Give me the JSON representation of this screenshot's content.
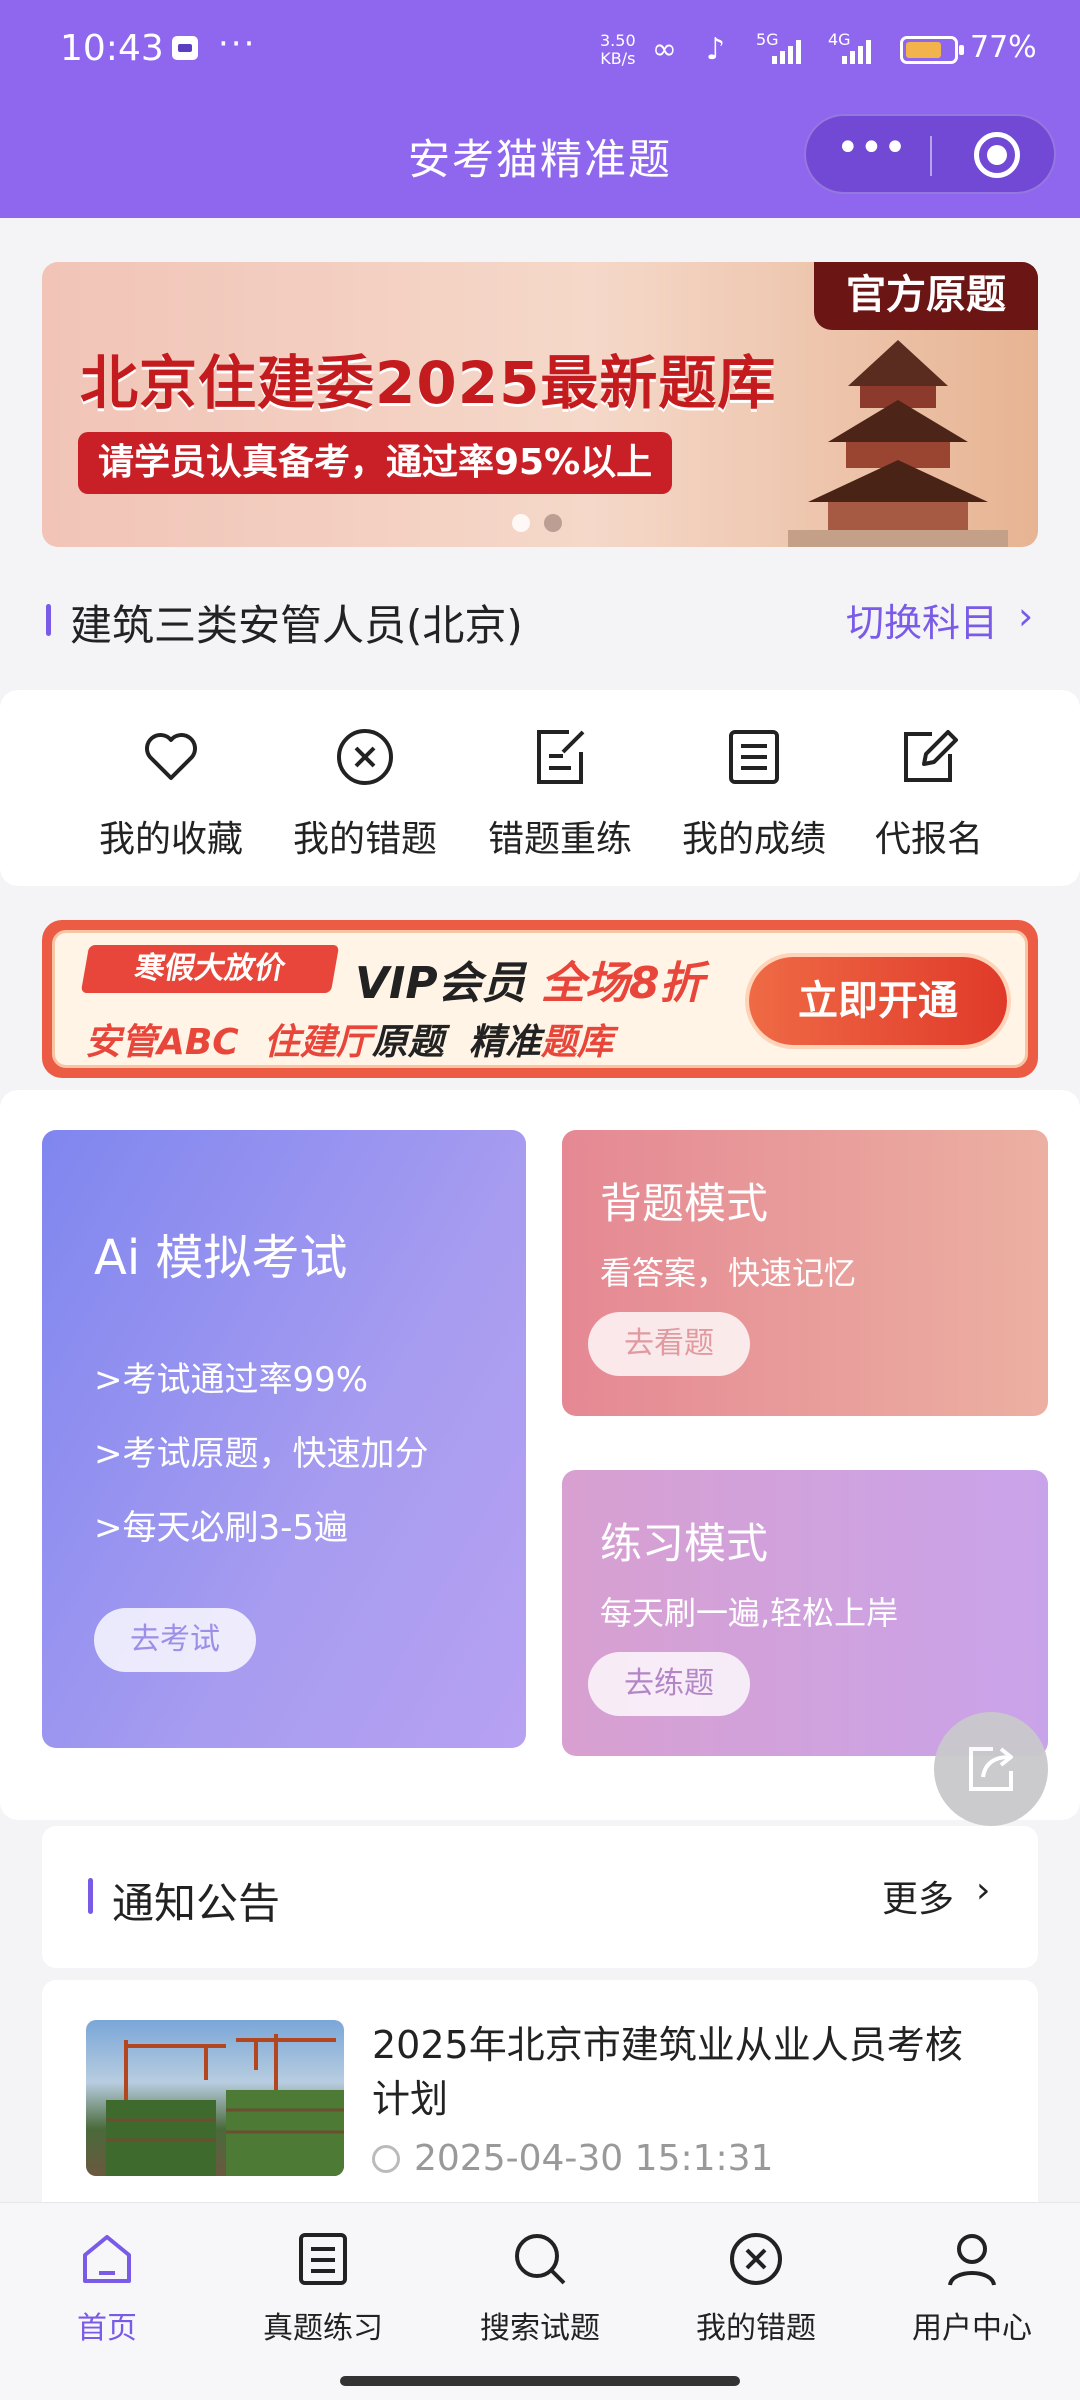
{
  "status_bar": {
    "time": "10:43",
    "dots": "···",
    "speed_value": "3.50",
    "speed_unit": "KB/s",
    "net1": "5G",
    "net2": "4G",
    "battery_percent_label": "77%",
    "battery_level": 0.77
  },
  "nav": {
    "title": "安考猫精准题",
    "more_icon": "more-dots-icon",
    "close_icon": "target-circle-icon"
  },
  "banner": {
    "tag": "官方原题",
    "headline": "北京住建委2025最新题库",
    "subline": "请学员认真备考，通过率95%以上",
    "slides": 2,
    "active_slide": 1
  },
  "subject": {
    "name": "建筑三类安管人员(北京)",
    "switch_label": "切换科目",
    "chevron": "›"
  },
  "quick_menu": [
    {
      "label": "我的收藏",
      "icon": "heart-icon"
    },
    {
      "label": "我的错题",
      "icon": "x-circle-icon"
    },
    {
      "label": "错题重练",
      "icon": "edit-doc-icon"
    },
    {
      "label": "我的成绩",
      "icon": "doc-lines-icon"
    },
    {
      "label": "代报名",
      "icon": "pencil-square-icon"
    }
  ],
  "promo": {
    "tag": "寒假大放价",
    "vip_prefix": "VIP会员",
    "vip_highlight": "全场8折",
    "line2_a": "安管ABC",
    "line2_b": "住建厅",
    "line2_c": "原题",
    "line2_d": "精准",
    "line2_e": "题库",
    "cta": "立即开通"
  },
  "modes": {
    "exam": {
      "title": "Ai 模拟考试",
      "points": [
        ">考试通过率99%",
        ">考试原题，快速加分",
        ">每天必刷3-5遍"
      ],
      "button": "去考试"
    },
    "recite": {
      "title": "背题模式",
      "desc": "看答案，快速记忆",
      "button": "去看题"
    },
    "practice": {
      "title": "练习模式",
      "desc": "每天刷一遍,轻松上岸",
      "button": "去练题"
    }
  },
  "notice": {
    "title": "通知公告",
    "more": "更多",
    "chevron": "›",
    "items": [
      {
        "title": "2025年北京市建筑业从业人员考核计划",
        "date": "2025-04-30 15:1:31"
      }
    ]
  },
  "tabbar": [
    {
      "label": "首页",
      "icon": "home-icon",
      "active": true
    },
    {
      "label": "真题练习",
      "icon": "doc-lines-icon",
      "active": false
    },
    {
      "label": "搜索试题",
      "icon": "search-icon",
      "active": false
    },
    {
      "label": "我的错题",
      "icon": "x-circle-icon",
      "active": false
    },
    {
      "label": "用户中心",
      "icon": "user-icon",
      "active": false
    }
  ],
  "colors": {
    "primary": "#8f67ef",
    "accent": "#7a5be8",
    "promo_red": "#e8463a"
  }
}
